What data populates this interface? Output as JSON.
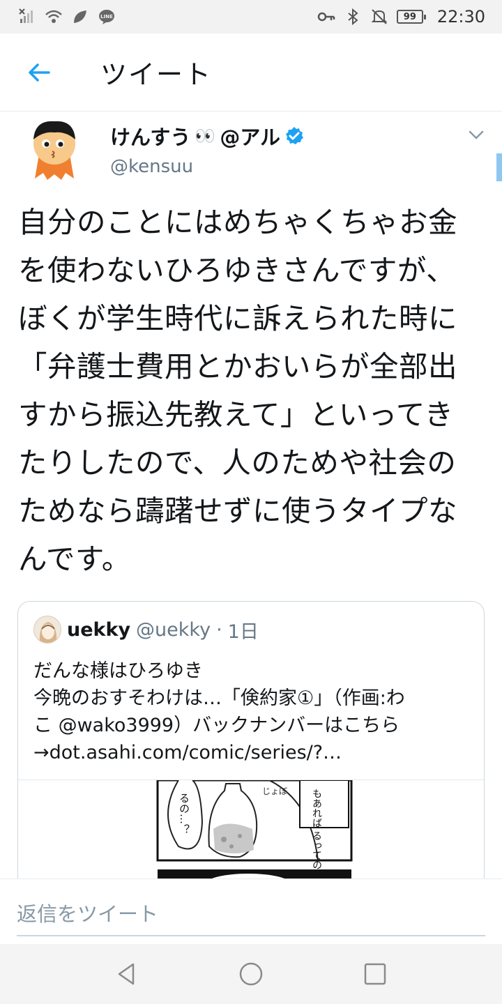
{
  "status_bar": {
    "battery": "99",
    "time": "22:30",
    "icons": [
      "no-sim-icon",
      "wifi-icon",
      "leaf-icon",
      "line-app-icon",
      "key-icon",
      "bluetooth-icon",
      "mute-icon"
    ]
  },
  "header": {
    "title": "ツイート",
    "back_icon": "arrow-left-icon"
  },
  "tweet": {
    "display_name": "けんすう",
    "name_emoji": "👀",
    "name_suffix": "@アル",
    "handle": "@kensuu",
    "verified": true,
    "text": "自分のことにはめちゃくちゃお金\nを使わないひろゆきさんですが、\nぼくが学生時代に訴えられた時に\n「弁護士費用とかおいらが全部出\nすから振込先教えて」といってき\nたりしたので、人のためや社会の\nためなら躊躇せずに使うタイプな\nんです。"
  },
  "quoted_tweet": {
    "name": "uekky",
    "handle": "@uekky",
    "separator": "·",
    "time": "1日",
    "text": "だんな様はひろゆき\n今晩のおすそわけは…「倹約家①」（作画:わ\nこ @wako3999）バックナンバーはこちら\n→dot.asahi.com/comic/series/?…",
    "manga_text_1": "るの…？",
    "manga_text_2": "もあれば\nるってのは",
    "manga_text_3": "じょぼ"
  },
  "reply": {
    "placeholder": "返信をツイート"
  },
  "colors": {
    "accent": "#1da1f2",
    "secondary_text": "#657786",
    "border": "#ccd6dd"
  }
}
